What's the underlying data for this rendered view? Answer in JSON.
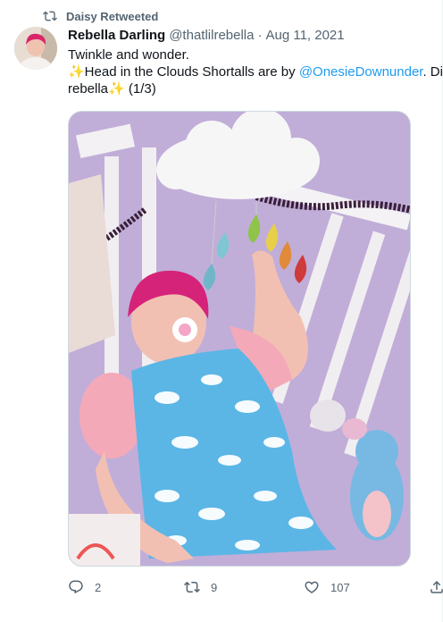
{
  "retweet": {
    "label": "Daisy Retweeted"
  },
  "tweet": {
    "display_name": "Rebella Darling",
    "handle": "@thatlilrebella",
    "separator": "·",
    "date": "Aug 11, 2021",
    "line1": "Twinkle and wonder.",
    "line2_prefix": "✨Head in the Clouds Shortalls are by ",
    "mention": "@OnesieDownunder",
    "line2_suffix": ". Dis",
    "line3": "rebella✨ (1/3)"
  },
  "actions": {
    "reply_count": "2",
    "retweet_count": "9",
    "like_count": "107"
  },
  "colors": {
    "link": "#1d9bf0",
    "secondary": "#536471",
    "primary_text": "#0f1419"
  },
  "icons": [
    "retweet-icon",
    "reply-icon",
    "like-icon",
    "share-icon"
  ]
}
